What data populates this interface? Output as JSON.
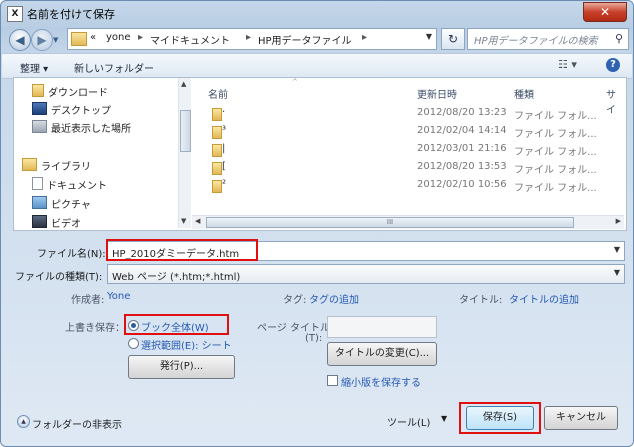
{
  "window": {
    "title": "名前を付けて保存",
    "app_icon": "X",
    "close_label": "✕"
  },
  "address": {
    "overflow": "«",
    "crumbs": [
      "yone",
      "マイドキュメント",
      "HP用データファイル"
    ],
    "search_placeholder": "HP用データファイルの検索"
  },
  "toolbar": {
    "organize": "整理 ▾",
    "new_folder": "新しいフォルダー",
    "view": "☷ ▾",
    "help": "?"
  },
  "nav": {
    "items": [
      {
        "label": "ダウンロード"
      },
      {
        "label": "デスクトップ"
      },
      {
        "label": "最近表示した場所"
      },
      {
        "label": "ライブラリ"
      },
      {
        "label": "ドキュメント"
      },
      {
        "label": "ピクチャ"
      },
      {
        "label": "ビデオ"
      }
    ]
  },
  "files": {
    "headers": {
      "name": "名前",
      "date": "更新日時",
      "type": "種類",
      "size": "サイ"
    },
    "rows": [
      {
        "name": "·",
        "date": "2012/08/20 13:23",
        "type": "ファイル フォル..."
      },
      {
        "name": "³",
        "date": "2012/02/04 14:14",
        "type": "ファイル フォル..."
      },
      {
        "name": "|",
        "date": "2012/03/01 21:16",
        "type": "ファイル フォル..."
      },
      {
        "name": "[",
        "date": "2012/08/20 13:53",
        "type": "ファイル フォル..."
      },
      {
        "name": "²",
        "date": "2012/02/10 10:56",
        "type": "ファイル フォル..."
      }
    ],
    "hscroll_grip": "III"
  },
  "form": {
    "filename_label": "ファイル名(N):",
    "filename_value": "HP_2010ダミーデータ.htm",
    "filetype_label": "ファイルの種類(T):",
    "filetype_value": "Web ページ (*.htm;*.html)",
    "author_label": "作成者:",
    "author_value": "Yone",
    "tags_label": "タグ:",
    "tags_value": "タグの追加",
    "title_label": "タイトル:",
    "title_value": "タイトルの追加",
    "overwrite_label": "上書き保存：",
    "opt_whole_book": "ブック全体(W)",
    "opt_selection": "選択範囲(E): シート",
    "publish_button": "発行(P)...",
    "page_title_label": "ページ タイトル",
    "page_title_label2": "(T):",
    "change_title_button": "タイトルの変更(C)...",
    "thumbnail_label": "縮小版を保存する"
  },
  "footer": {
    "hide_folders": "フォルダーの非表示",
    "tools": "ツール(L)",
    "save_button": "保存(S)",
    "cancel_button": "キャンセル"
  }
}
